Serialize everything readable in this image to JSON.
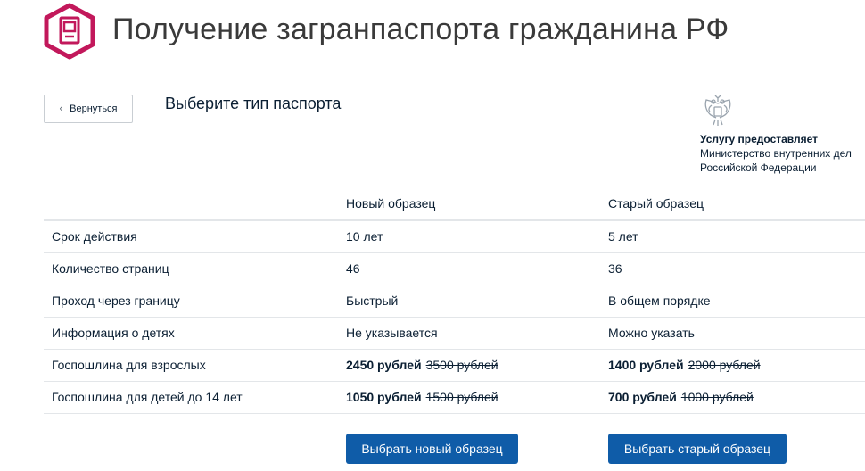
{
  "header": {
    "title": "Получение загранпаспорта гражданина РФ"
  },
  "back_button": {
    "label": "Вернуться"
  },
  "section_title": "Выберите тип паспорта",
  "provider": {
    "label": "Услугу предоставляет",
    "name_line1": "Министерство внутренних дел",
    "name_line2": "Российской Федерации"
  },
  "table": {
    "columns": [
      "",
      "Новый образец",
      "Старый образец"
    ],
    "rows": [
      {
        "label": "Срок действия",
        "new": "10 лет",
        "old": "5 лет"
      },
      {
        "label": "Количество страниц",
        "new": "46",
        "old": "36"
      },
      {
        "label": "Проход через границу",
        "new": "Быстрый",
        "old": "В общем порядке"
      },
      {
        "label": "Информация о детях",
        "new": "Не указывается",
        "old": "Можно указать"
      },
      {
        "label": "Госпошлина для взрослых",
        "new_price": "2450 рублей",
        "new_old_price": "3500 рублей",
        "old_price": "1400 рублей",
        "old_old_price": "2000 рублей"
      },
      {
        "label": "Госпошлина для детей до 14 лет",
        "new_price": "1050 рублей",
        "new_old_price": "1500 рублей",
        "old_price": "700 рублей",
        "old_old_price": "1000 рублей"
      }
    ]
  },
  "buttons": {
    "choose_new": "Выбрать новый образец",
    "choose_old": "Выбрать старый образец"
  },
  "colors": {
    "accent": "#0f5ca8",
    "logo": "#c2185b",
    "text": "#0b1f33"
  },
  "icons": {
    "logo": "passport-icon",
    "back": "chevron-left-icon",
    "emblem": "coat-of-arms-icon"
  }
}
